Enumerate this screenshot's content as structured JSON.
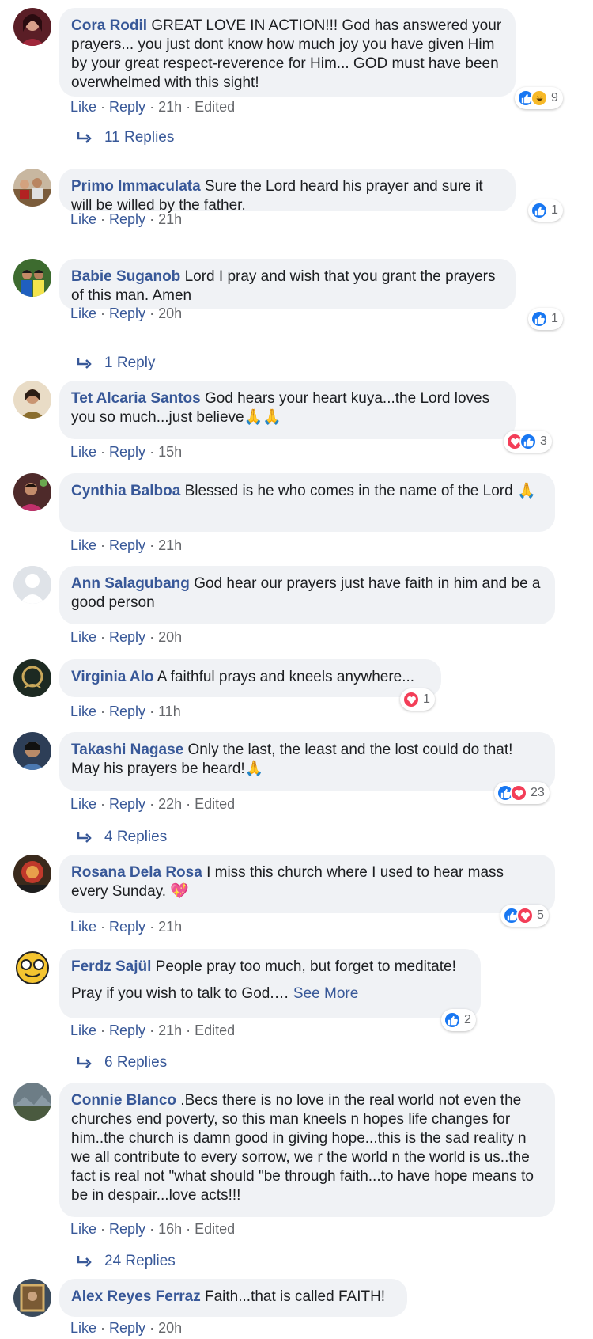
{
  "ui": {
    "like": "Like",
    "reply": "Reply",
    "sep": " · ",
    "edited": "Edited",
    "see_more": "See More"
  },
  "comments": [
    {
      "author": "Cora Rodil",
      "text": "GREAT LOVE IN ACTION!!! God has answered your prayers... you just dont know how much joy you have given Him by your great respect-reverence for Him... GOD must have been overwhelmed with this sight!",
      "time": "21h",
      "edited": true,
      "reaction_icons": [
        "like",
        "haha"
      ],
      "reaction_count": "9",
      "replies": "11 Replies"
    },
    {
      "author": "Primo Immaculata",
      "text": "Sure the Lord heard his prayer and sure it will be willed by the father.",
      "time": "21h",
      "edited": false,
      "reaction_icons": [
        "like"
      ],
      "reaction_count": "1"
    },
    {
      "author": "Babie Suganob",
      "text": "Lord I pray and wish that you grant the prayers of this man. Amen",
      "time": "20h",
      "edited": false,
      "reaction_icons": [
        "like"
      ],
      "reaction_count": "1",
      "replies": "1 Reply"
    },
    {
      "author": "Tet Alcaria Santos",
      "text": "God hears your heart kuya...the Lord loves you so much...just believe🙏🙏",
      "time": "15h",
      "edited": false,
      "reaction_icons": [
        "love",
        "like"
      ],
      "reaction_count": "3"
    },
    {
      "author": "Cynthia Balboa",
      "text": "Blessed is he who comes in the name of the Lord 🙏",
      "time": "21h",
      "edited": false
    },
    {
      "author": "Ann Salagubang",
      "text": "God hear our prayers just have faith in him and be a good person",
      "time": "20h",
      "edited": false
    },
    {
      "author": "Virginia Alo",
      "text": "A faithful prays and kneels anywhere...",
      "time": "11h",
      "edited": false,
      "reaction_icons": [
        "love"
      ],
      "reaction_count": "1"
    },
    {
      "author": "Takashi Nagase",
      "text": "Only the last, the least and the lost could do that! May his prayers be heard!🙏",
      "time": "22h",
      "edited": true,
      "reaction_icons": [
        "like",
        "love"
      ],
      "reaction_count": "23",
      "replies": "4 Replies"
    },
    {
      "author": "Rosana Dela Rosa",
      "text": "I miss this church where I used to hear mass every Sunday. 💖",
      "time": "21h",
      "edited": false,
      "reaction_icons": [
        "like",
        "love"
      ],
      "reaction_count": "5"
    },
    {
      "author": "Ferdz Sajül",
      "text": "People pray too much, but forget to meditate!",
      "text2": "Pray if you wish to talk to God.…",
      "time": "21h",
      "edited": true,
      "reaction_icons": [
        "like"
      ],
      "reaction_count": "2",
      "replies": "6 Replies"
    },
    {
      "author": "Connie Blanco",
      "text": ".Becs there is no love in the real world not even the churches end poverty, so this man kneels n hopes life changes for him..the church is damn good in giving hope...this is the sad reality n we all contribute to every sorrow, we r the world n the world is us..the fact is real not \"what should \"be through faith...to have hope means to be in despair...love acts!!!",
      "time": "16h",
      "edited": true,
      "replies": "24 Replies"
    },
    {
      "author": "Alex Reyes Ferraz",
      "text": "Faith...that is called FAITH!",
      "time": "20h",
      "edited": false
    }
  ],
  "colors": {
    "link": "#385898",
    "meta": "#65676b",
    "bubble": "#f0f2f5",
    "like": "#1877f2",
    "love": "#f33e58",
    "haha": "#f7b928"
  },
  "icons": {
    "reply_arrow": "reply-arrow-icon",
    "like": "like-reaction-icon",
    "love": "love-reaction-icon",
    "haha": "haha-reaction-icon"
  }
}
